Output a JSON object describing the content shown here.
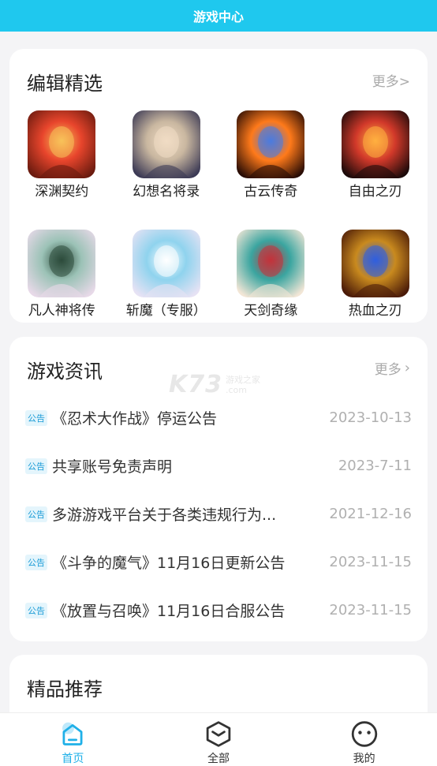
{
  "header": {
    "title": "游戏中心"
  },
  "editors_pick": {
    "title": "编辑精选",
    "more": "更多>",
    "games": [
      {
        "name": "深渊契约",
        "c1": "#e8452c",
        "c2": "#6b1b0f",
        "c3": "#f7c25a"
      },
      {
        "name": "幻想名将录",
        "c1": "#c9b7a0",
        "c2": "#3c3a55",
        "c3": "#f1dcc4"
      },
      {
        "name": "古云传奇",
        "c1": "#ff7a1a",
        "c2": "#2a0d05",
        "c3": "#4a7be0"
      },
      {
        "name": "自由之刃",
        "c1": "#d2392a",
        "c2": "#1c0a0a",
        "c3": "#ffb040"
      },
      {
        "name": "凡人神将传",
        "c1": "#9bc2b6",
        "c2": "#e7d9e8",
        "c3": "#2c4b3b"
      },
      {
        "name": "斩魔（专服）",
        "c1": "#8fd3ee",
        "c2": "#e6e2f4",
        "c3": "#ffffff"
      },
      {
        "name": "天剑奇缘",
        "c1": "#3aa5a0",
        "c2": "#f2e6d6",
        "c3": "#c4323a"
      },
      {
        "name": "热血之刃",
        "c1": "#c98a1e",
        "c2": "#4a1a08",
        "c3": "#2f5fe0"
      }
    ]
  },
  "news": {
    "title": "游戏资讯",
    "more": "更多",
    "watermark": {
      "brand": "K73",
      "line1": "游戏之家",
      "line2": ".com"
    },
    "items": [
      {
        "tag": "公告",
        "title": "《忍术大作战》停运公告",
        "date": "2023-10-13"
      },
      {
        "tag": "公告",
        "title": "共享账号免责声明",
        "date": "2023-7-11"
      },
      {
        "tag": "公告",
        "title": "多游游戏平台关于各类违规行为...",
        "date": "2021-12-16"
      },
      {
        "tag": "公告",
        "title": "《斗争的魔气》11月16日更新公告",
        "date": "2023-11-15"
      },
      {
        "tag": "公告",
        "title": "《放置与召唤》11月16日合服公告",
        "date": "2023-11-15"
      }
    ]
  },
  "recommend": {
    "title": "精品推荐"
  },
  "bottom_nav": [
    {
      "label": "首页",
      "icon": "home-icon",
      "active": true
    },
    {
      "label": "全部",
      "icon": "box-icon",
      "active": false
    },
    {
      "label": "我的",
      "icon": "smile-icon",
      "active": false
    }
  ],
  "colors": {
    "accent": "#1fc8ee",
    "tag_text": "#1a9bd6",
    "tag_bg": "#e4f5fc"
  }
}
